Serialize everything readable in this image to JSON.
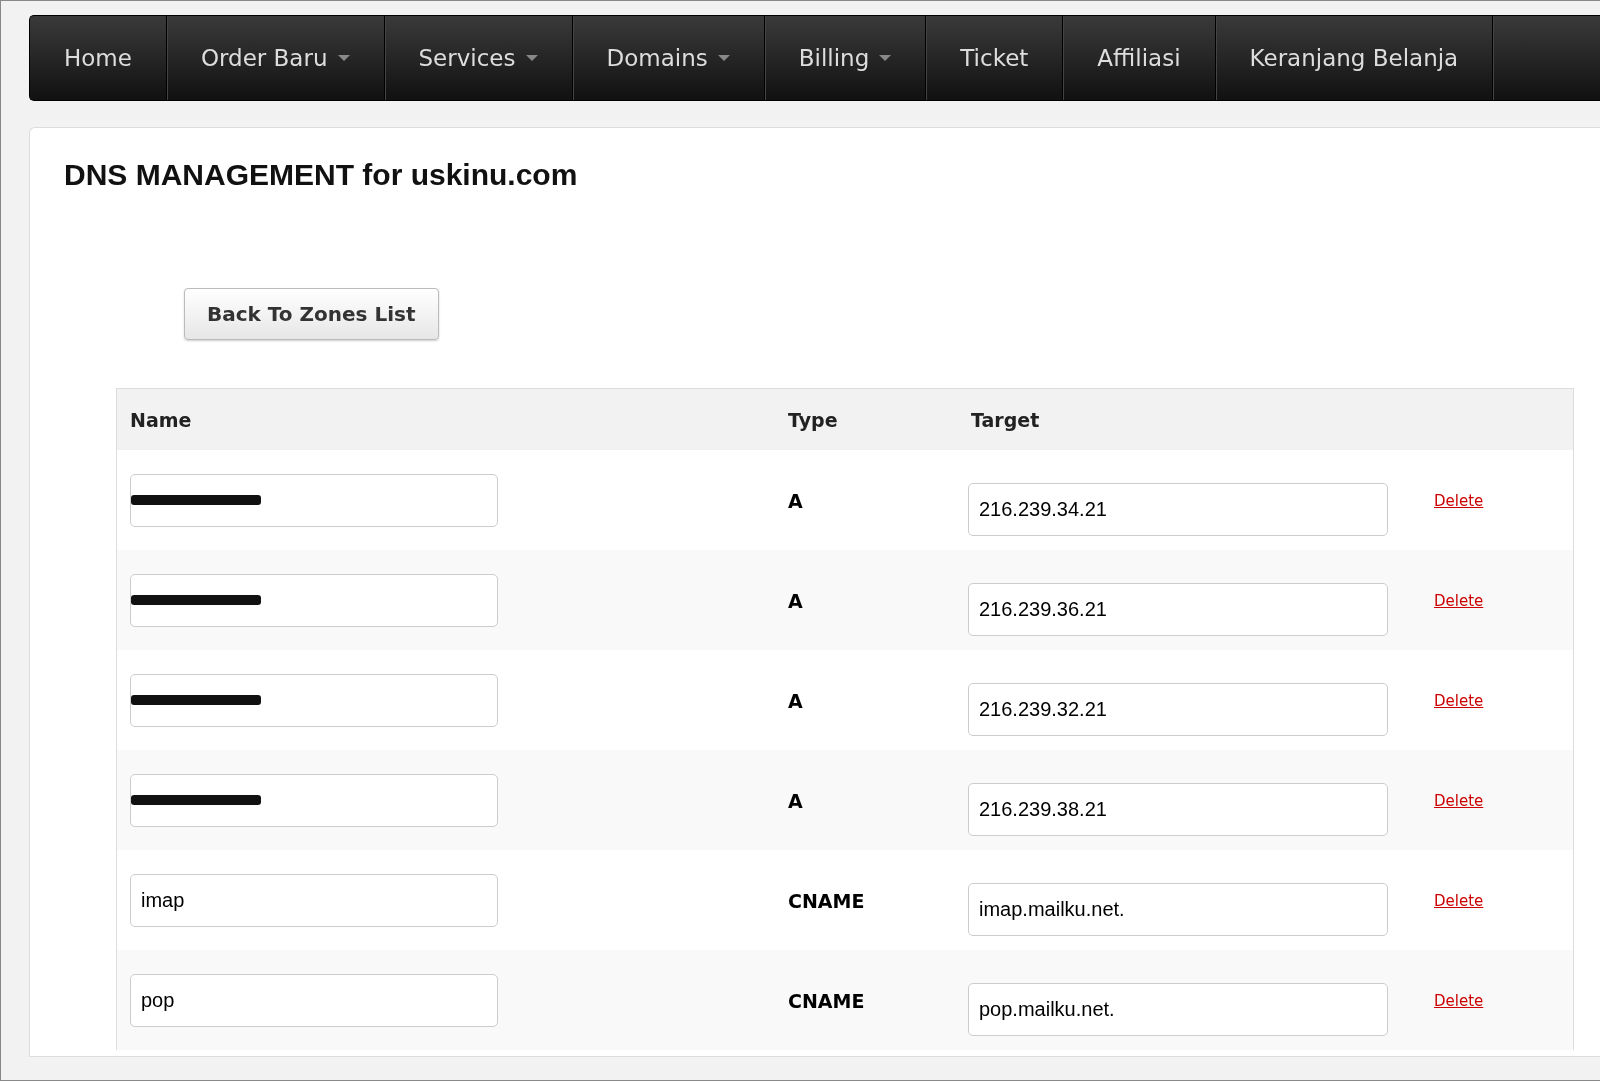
{
  "nav": [
    {
      "label": "Home",
      "dropdown": false
    },
    {
      "label": "Order Baru",
      "dropdown": true
    },
    {
      "label": "Services",
      "dropdown": true
    },
    {
      "label": "Domains",
      "dropdown": true
    },
    {
      "label": "Billing",
      "dropdown": true
    },
    {
      "label": "Ticket",
      "dropdown": false
    },
    {
      "label": "Affiliasi",
      "dropdown": false
    },
    {
      "label": "Keranjang Belanja",
      "dropdown": false
    }
  ],
  "title": "DNS MANAGEMENT for uskinu.com",
  "back_button": "Back To Zones List",
  "table": {
    "columns": [
      "Name",
      "Type",
      "Target"
    ],
    "rows": [
      {
        "redacted": true,
        "type": "A",
        "target": "216.239.34.21",
        "action": "Delete"
      },
      {
        "redacted": true,
        "type": "A",
        "target": "216.239.36.21",
        "action": "Delete"
      },
      {
        "redacted": true,
        "type": "A",
        "target": "216.239.32.21",
        "action": "Delete"
      },
      {
        "redacted": true,
        "type": "A",
        "target": "216.239.38.21",
        "action": "Delete"
      },
      {
        "redacted": false,
        "name": "imap",
        "type": "CNAME",
        "target": "imap.mailku.net.",
        "action": "Delete"
      },
      {
        "redacted": false,
        "name": "pop",
        "type": "CNAME",
        "target": "pop.mailku.net.",
        "action": "Delete"
      }
    ]
  }
}
